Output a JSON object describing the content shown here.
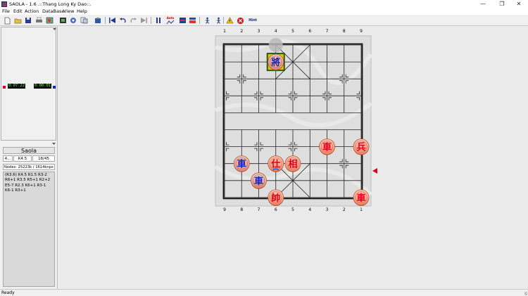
{
  "window": {
    "title": "SAOLA - 1.6 .::Thang Long Ky Dao::.",
    "minimize_glyph": "—",
    "maximize_glyph": "❐",
    "close_glyph": "✕"
  },
  "menu": [
    "File",
    "Edit",
    "Action",
    "DataBase",
    "View",
    "Help"
  ],
  "toolbar": {
    "icons": [
      "new-game-icon",
      "open-file-icon",
      "save-icon",
      "print-icon",
      "setup-board-icon",
      "flip-board-icon",
      "engine-icon",
      "copy-icon",
      "paste-icon",
      "first-move-icon",
      "undo-icon",
      "redo-icon",
      "last-move-icon",
      "pause-icon",
      "auto-play-icon",
      "book-icon",
      "database-icon",
      "figure-icon",
      "warning-icon",
      "stop-icon",
      "hint-button"
    ],
    "auto_label": "Auto",
    "hint_label": "Hint"
  },
  "clock": {
    "red_time": "0:07:22",
    "blue_time": "0:00:01",
    "red_color": "#e0001b",
    "blue_color": "#0030c8"
  },
  "engine": {
    "name": "Saola",
    "depth": "4...",
    "best_move": "K4.5",
    "progress": "18/45",
    "nodes": "Nodes: 25223k / 1614knps",
    "pv": "(R3.6) K4.5 R1.5 R3-2 R6+1 R3.5 R5+1 R2+2 E5-7 R2.3 K6+1 R3-1 K6-1 R3+1"
  },
  "board": {
    "top_files": [
      "1",
      "2",
      "3",
      "4",
      "5",
      "6",
      "7",
      "8",
      "9"
    ],
    "bottom_files": [
      "9",
      "8",
      "7",
      "6",
      "5",
      "4",
      "3",
      "2",
      "1"
    ],
    "pieces": [
      {
        "char": "將",
        "side": "blue",
        "file": 3,
        "rank": 1,
        "highlight": true
      },
      {
        "char": "車",
        "side": "red",
        "file": 6,
        "rank": 6
      },
      {
        "char": "兵",
        "side": "red",
        "file": 8,
        "rank": 6
      },
      {
        "char": "車",
        "side": "blue",
        "file": 1,
        "rank": 7
      },
      {
        "char": "仕",
        "side": "red",
        "file": 3,
        "rank": 7,
        "selected": true
      },
      {
        "char": "相",
        "side": "red",
        "file": 4,
        "rank": 7
      },
      {
        "char": "車",
        "side": "blue",
        "file": 2,
        "rank": 8
      },
      {
        "char": "帥",
        "side": "red",
        "file": 3,
        "rank": 9
      },
      {
        "char": "車",
        "side": "red",
        "file": 8,
        "rank": 9
      }
    ],
    "ghost": {
      "file": 3,
      "rank": 0
    },
    "turn_color": "#e0001b"
  },
  "status": "Ready"
}
